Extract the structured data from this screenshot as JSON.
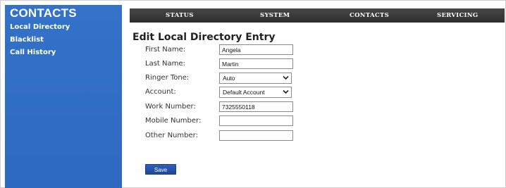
{
  "sidebar": {
    "title": "CONTACTS",
    "items": [
      {
        "label": "Local Directory"
      },
      {
        "label": "Blacklist"
      },
      {
        "label": "Call History"
      }
    ]
  },
  "topnav": {
    "tabs": [
      {
        "label": "STATUS"
      },
      {
        "label": "SYSTEM"
      },
      {
        "label": "CONTACTS"
      },
      {
        "label": "SERVICING"
      }
    ]
  },
  "main": {
    "title": "Edit Local Directory Entry",
    "fields": {
      "first_name": {
        "label": "First Name:",
        "value": "Angela"
      },
      "last_name": {
        "label": "Last Name:",
        "value": "Martin"
      },
      "ringer_tone": {
        "label": "Ringer Tone:",
        "value": "Auto"
      },
      "account": {
        "label": "Account:",
        "value": "Default Account"
      },
      "work_number": {
        "label": "Work Number:",
        "value": "7325550118"
      },
      "mobile_number": {
        "label": "Mobile Number:",
        "value": ""
      },
      "other_number": {
        "label": "Other Number:",
        "value": ""
      }
    },
    "save_label": "Save"
  },
  "colors": {
    "sidebar_bg": "#2f6ec5",
    "nav_bg": "#3a3a3a",
    "button_bg": "#2653a8"
  }
}
